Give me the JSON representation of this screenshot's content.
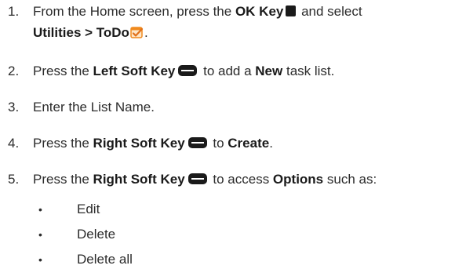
{
  "steps": [
    {
      "num": "1.",
      "parts": {
        "a": "From the Home screen, press the ",
        "b": "OK Key",
        "c": " and select",
        "d": "Utilities > ToDo",
        "e": "."
      }
    },
    {
      "num": "2.",
      "parts": {
        "a": "Press the ",
        "b": "Left Soft Key",
        "c": " to add a ",
        "d": "New",
        "e": " task list."
      }
    },
    {
      "num": "3.",
      "parts": {
        "a": "Enter the List Name."
      }
    },
    {
      "num": "4.",
      "parts": {
        "a": "Press the ",
        "b": "Right Soft Key",
        "c": " to ",
        "d": "Create",
        "e": "."
      }
    },
    {
      "num": "5.",
      "parts": {
        "a": "Press the ",
        "b": "Right Soft Key",
        "c": " to access ",
        "d": "Options",
        "e": " such as:"
      }
    }
  ],
  "options": [
    {
      "bullet": "•",
      "label": "Edit"
    },
    {
      "bullet": "•",
      "label": "Delete"
    },
    {
      "bullet": "•",
      "label": "Delete all"
    }
  ],
  "icons": {
    "ok_key": "ok-key-icon",
    "soft_key": "soft-key-icon",
    "todo_app": "todo-app-icon"
  },
  "colors": {
    "text": "#2b2b2b",
    "icon": "#1a1a1a",
    "todo_orange": "#f08a1e"
  }
}
